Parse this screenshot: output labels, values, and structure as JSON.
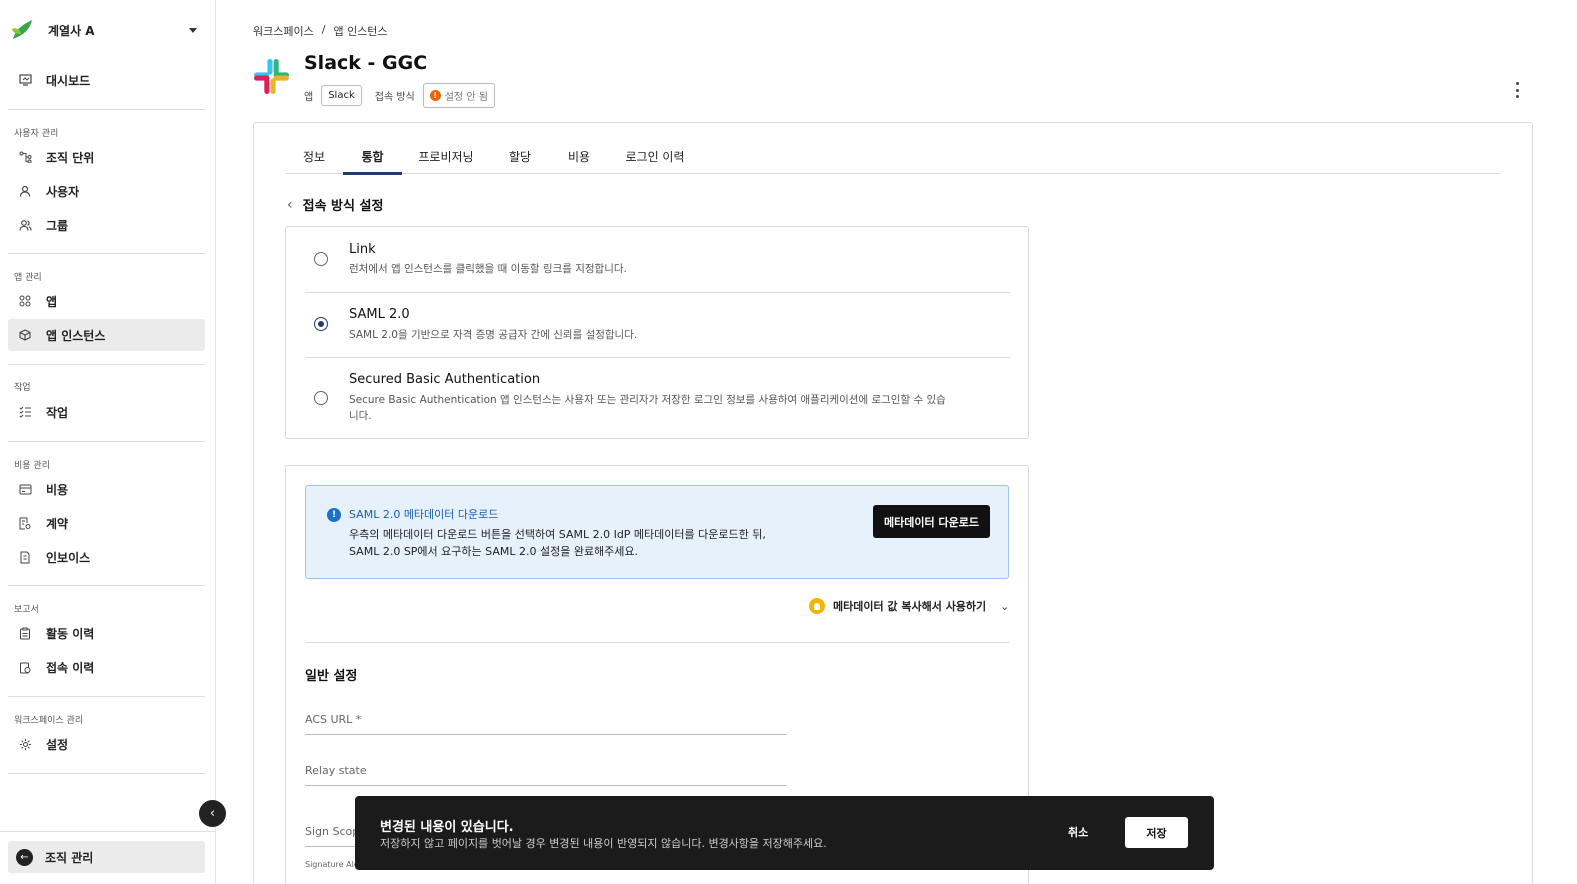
{
  "sidebar": {
    "workspace_name": "계열사 A",
    "dashboard": "대시보드",
    "sections": {
      "user_mgmt": "사용자 관리",
      "app_mgmt": "앱 관리",
      "tasks": "작업",
      "cost_mgmt": "비용 관리",
      "reports": "보고서",
      "workspace_mgmt": "워크스페이스 관리"
    },
    "items": {
      "org_unit": "조직 단위",
      "users": "사용자",
      "groups": "그룹",
      "apps": "앱",
      "app_instances": "앱 인스턴스",
      "tasks": "작업",
      "cost": "비용",
      "contracts": "계약",
      "invoices": "인보이스",
      "activity_log": "활동 이력",
      "access_log": "접속 이력",
      "settings": "설정"
    },
    "org_management": "조직 관리"
  },
  "breadcrumb": {
    "root": "워크스페이스",
    "sep": "/",
    "current": "앱 인스턴스"
  },
  "app": {
    "title": "Slack - GGC",
    "app_label": "앱",
    "app_chip": "Slack",
    "access_label": "접속 방식",
    "access_chip": "설정 안 됨"
  },
  "tabs": [
    "정보",
    "통합",
    "프로비저닝",
    "할당",
    "비용",
    "로그인 이력"
  ],
  "active_tab": 1,
  "access_settings": {
    "title": "접속 방식 설정",
    "options": [
      {
        "title": "Link",
        "desc": "런처에서 앱 인스턴스를 클릭했을 때 이동할 링크를 지정합니다.",
        "selected": false
      },
      {
        "title": "SAML 2.0",
        "desc": "SAML 2.0을 기반으로 자격 증명 공급자 간에 신뢰를 설정합니다.",
        "selected": true
      },
      {
        "title": "Secured Basic Authentication",
        "desc": "Secure Basic Authentication 앱 인스턴스는 사용자 또는 관리자가 저장한 로그인 정보를 사용하여 애플리케이션에 로그인할 수 있습니다.",
        "selected": false
      }
    ]
  },
  "saml": {
    "info_title": "SAML 2.0 메타데이터 다운로드",
    "info_line1": "우측의 메타데이터 다운로드 버튼을 선택하여 SAML 2.0 IdP 메타데이터를 다운로드한 뒤,",
    "info_line2": "SAML 2.0 SP에서 요구하는 SAML 2.0 설정을 완료해주세요.",
    "download_button": "메타데이터 다운로드",
    "copy_toggle": "메타데이터 값 복사해서 사용하기",
    "general_title": "일반 설정",
    "fields": {
      "acs_url": "ACS URL *",
      "relay_state": "Relay state",
      "sign_scope": "Sign Scope *",
      "signature_algorithm": "Signature Algorithm *"
    }
  },
  "toast": {
    "title": "변경된 내용이 있습니다.",
    "desc": "저장하지 않고 페이지를 벗어날 경우 변경된 내용이 반영되지 않습니다. 변경사항을 저장해주세요.",
    "cancel": "취소",
    "save": "저장"
  },
  "colors": {
    "accent": "#1f3a6b",
    "info_bg": "#e7f1fc",
    "warn": "#e8650f",
    "toast_bg": "#1b1b1b"
  }
}
